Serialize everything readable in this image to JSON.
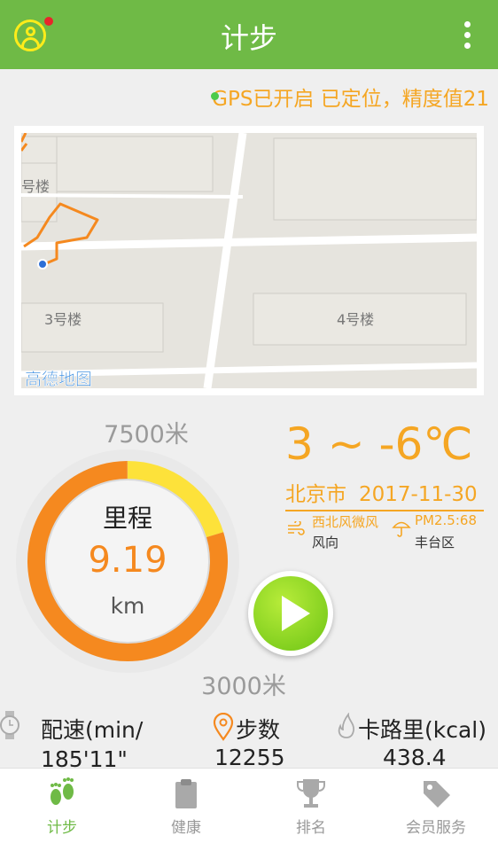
{
  "header": {
    "title": "计步"
  },
  "gps_status": "GPS已开启 已定位，精度值21",
  "map": {
    "labels": [
      "号楼",
      "3号楼",
      "4号楼"
    ],
    "provider": "高德地图"
  },
  "gauge": {
    "label": "里程",
    "value": "9.19",
    "unit": "km",
    "top_label": "7500米",
    "bottom_label": "3000米",
    "progress_fraction": 0.82,
    "colors": {
      "orange": "#f5891f",
      "yellow": "#fde23a"
    }
  },
  "weather": {
    "temperature": "3 ~ -6℃",
    "city": "北京市",
    "date": "2017-11-30",
    "wind_value": "西北风微风",
    "wind_label": "风向",
    "pm_value": "PM2.5:68",
    "district": "丰台区"
  },
  "stats": {
    "pace": {
      "label": "配速(min/",
      "value": "185'11\""
    },
    "steps": {
      "label": "步数",
      "value": "12255"
    },
    "calories": {
      "label": "卡路里(kcal)",
      "value": "438.4"
    }
  },
  "nav": [
    {
      "label": "计步",
      "icon": "footprints-icon",
      "active": true
    },
    {
      "label": "健康",
      "icon": "clipboard-icon",
      "active": false
    },
    {
      "label": "排名",
      "icon": "trophy-icon",
      "active": false
    },
    {
      "label": "会员服务",
      "icon": "tag-icon",
      "active": false
    }
  ],
  "colors": {
    "brand_green": "#6fba46",
    "accent_orange": "#f5a623"
  }
}
